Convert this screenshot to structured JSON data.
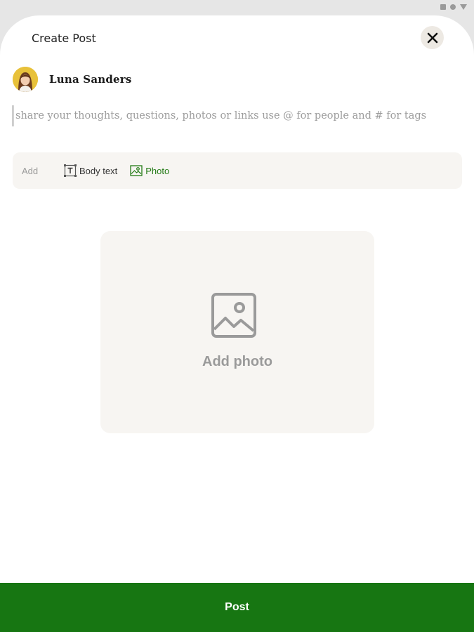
{
  "header": {
    "title": "Create Post",
    "close_icon": "close-icon"
  },
  "author": {
    "name": "Luna Sanders",
    "avatar_icon": "avatar"
  },
  "composer": {
    "value": "",
    "placeholder": "share your thoughts, questions, photos or links use @ for people and # for tags"
  },
  "add_bar": {
    "label": "Add",
    "options": [
      {
        "label": "Body text",
        "icon": "text-format-icon"
      },
      {
        "label": "Photo",
        "icon": "image-icon"
      }
    ]
  },
  "photo_drop": {
    "label": "Add photo",
    "icon": "image-placeholder-icon"
  },
  "footer": {
    "post_label": "Post"
  },
  "colors": {
    "brand_green": "#177612",
    "photo_option_green": "#237a15",
    "panel_bg": "#f7f5f2",
    "close_bg": "#ede9e3",
    "muted_text": "#9a9a9a"
  }
}
